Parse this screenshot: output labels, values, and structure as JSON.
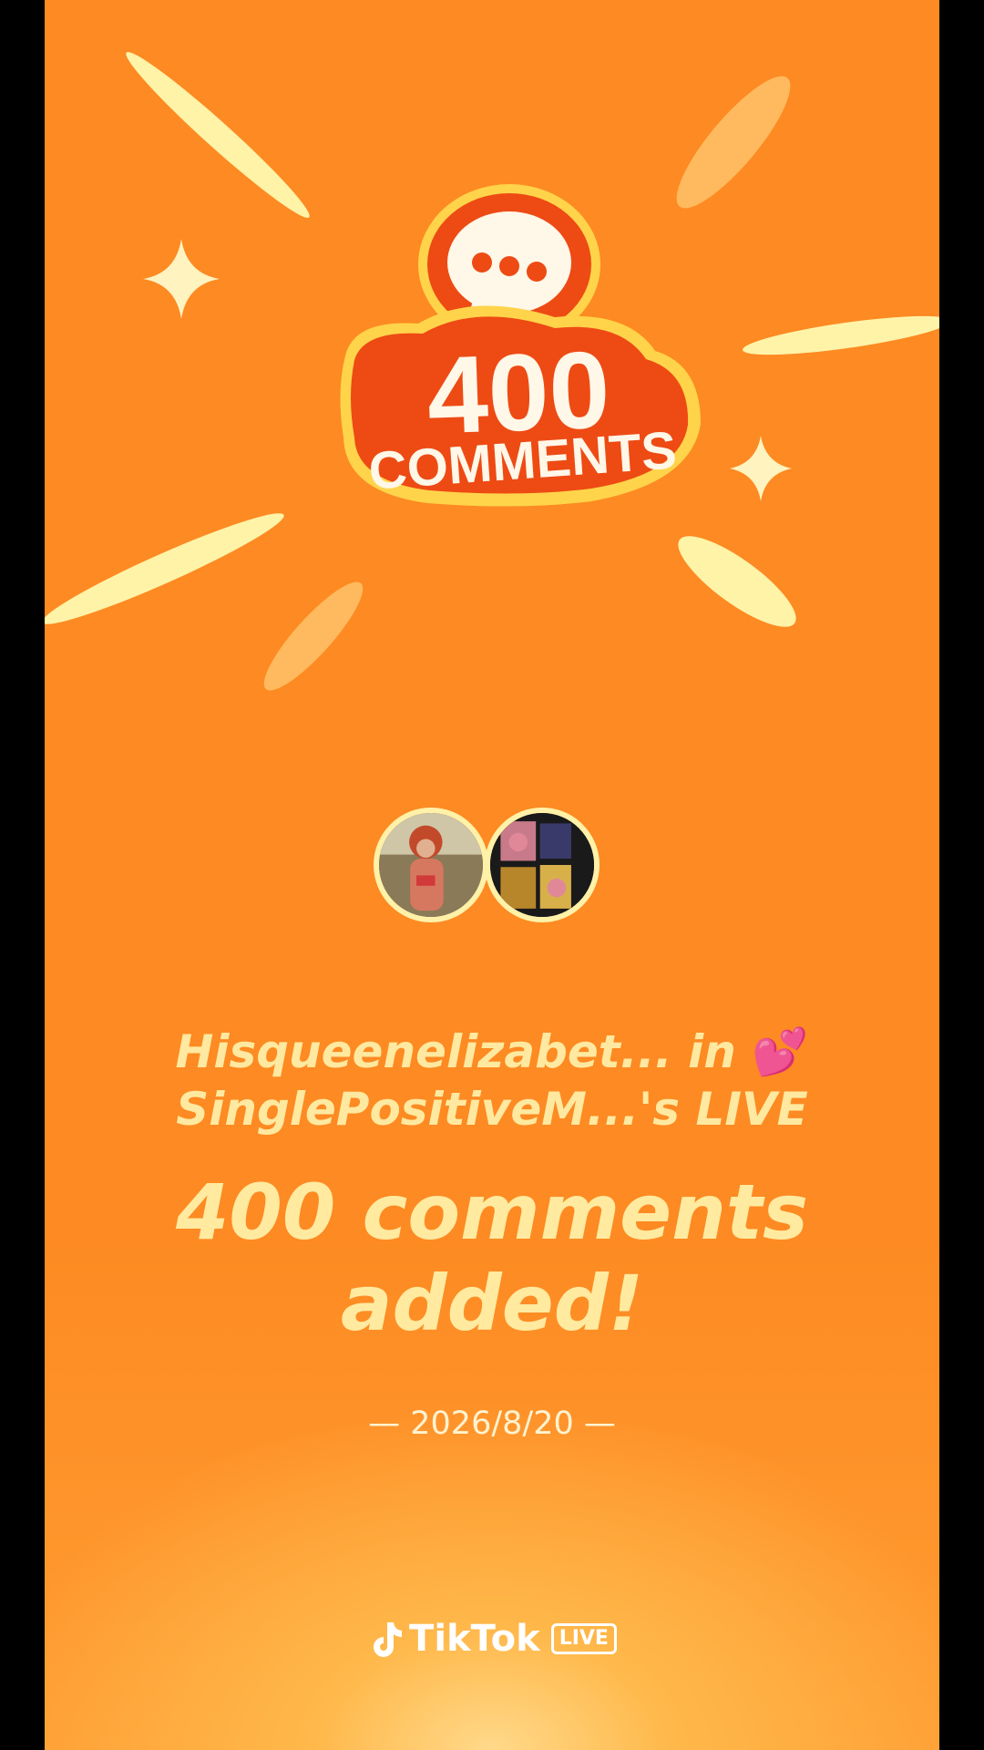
{
  "badge": {
    "number": "400",
    "word": "COMMENTS"
  },
  "headline": {
    "line1": "Hisqueenelizabet... in",
    "heart": "💕",
    "line2": "SinglePositiveM...'s LIVE"
  },
  "milestone": {
    "line1": "400 comments",
    "line2": "added!"
  },
  "date": "— 2026/8/20 —",
  "brand": {
    "name": "TikTok",
    "tag": "LIVE"
  },
  "colors": {
    "background": "#fd8a22",
    "badge_red": "#ee4a14",
    "text_cream": "#ffe9a0"
  },
  "icons": [
    "chat-bubble-icon",
    "sparkle-icon",
    "tiktok-note-icon"
  ]
}
